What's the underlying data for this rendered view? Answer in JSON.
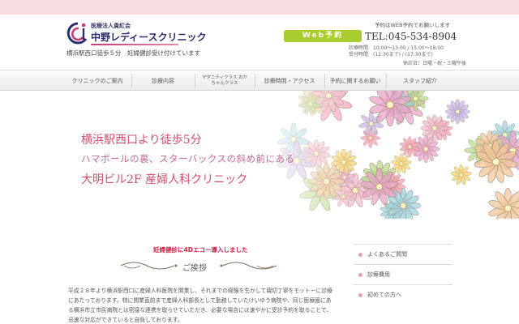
{
  "header": {
    "logo_small": "医療法人貴紅会",
    "logo_main": "中野レディースクリニック",
    "subtitle": "横浜駅西口徒歩５分　妊婦健診受け付けています",
    "note": "予約はWEB予約でお願いします",
    "web_button": "Web予約",
    "tel": "TEL:045-534-8904",
    "hours": [
      {
        "label": "診療時間",
        "value": "10:00〜13:00 / 15:00〜18:00"
      },
      {
        "label": "受付時間",
        "value": "(12:30まで) / (17:30まで)"
      }
    ],
    "closed": "休診日：日曜・祝・土曜午後"
  },
  "nav": {
    "items": [
      {
        "label": "クリニックのご案内"
      },
      {
        "label": "診療内容"
      },
      {
        "label": "マタニティクラス おかちゃんクラス"
      },
      {
        "label": "診療時間・アクセス"
      },
      {
        "label": "予約に関するお願い"
      },
      {
        "label": "スタッフ紹介"
      }
    ]
  },
  "hero": {
    "line1": "横浜駅西口より徒歩5分",
    "line2": "ハマボールの裏、スターバックスの斜め前にある",
    "line3": "大明ビル2F 産婦人科クリニック"
  },
  "main": {
    "news": "妊婦健診に4Dエコー導入しました",
    "greeting_title": "ご挨拶",
    "greeting_text": "平成２８年より横浜駅西口に産婦人科医院を開業し、それまでの経験を生かして親切丁寧をモットーに診療にあたっております。特に開業直前まで産婦人科部長として勤務していたけいゆう病院や、同じ医療圏にある横浜市立市民病院とは密接な連携を取らせていただき、必要な場合には速やかに受診予約を取ることで、迅速な対応ができていると自負しております。"
  },
  "sidebar": {
    "items": [
      {
        "label": "よくあるご質問"
      },
      {
        "label": "診療費用"
      },
      {
        "label": "初めての方へ"
      }
    ]
  },
  "colors": {
    "accent_pink": "#d04f6e",
    "web_green": "#a9cd2e",
    "logo_navy": "#2b2d6e"
  }
}
